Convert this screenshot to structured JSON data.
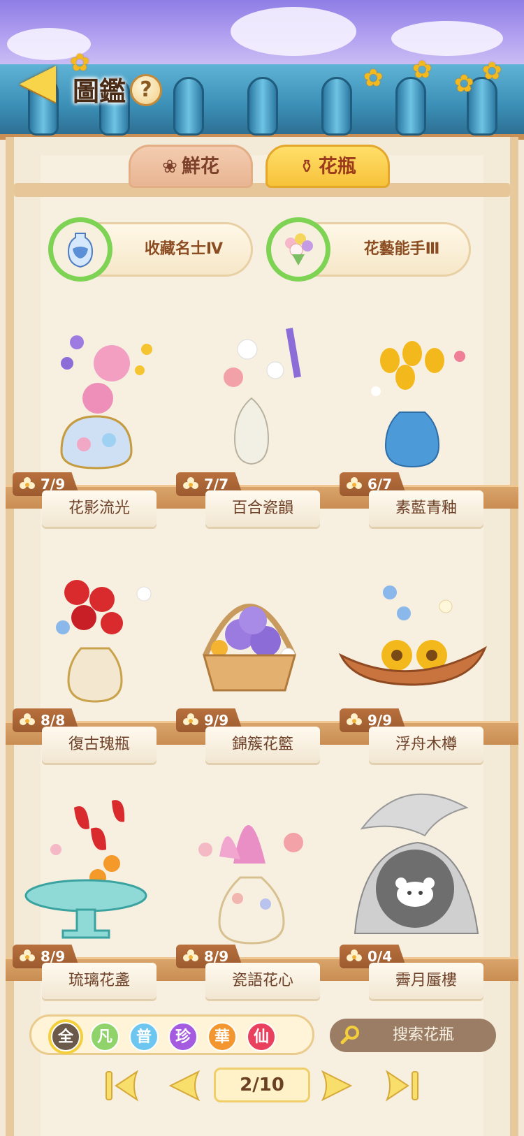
{
  "header": {
    "title": "圖鑑",
    "help_label": "?"
  },
  "tabs": [
    {
      "label": "鮮花",
      "active": false,
      "icon": "rose-icon"
    },
    {
      "label": "花瓶",
      "active": true,
      "icon": "vase-icon"
    }
  ],
  "achievements": [
    {
      "label": "收藏名士Ⅳ",
      "icon": "blue-vase-icon"
    },
    {
      "label": "花藝能手Ⅲ",
      "icon": "bouquet-icon"
    }
  ],
  "items": [
    {
      "name": "花影流光",
      "count": "7/9"
    },
    {
      "name": "百合瓷韻",
      "count": "7/7"
    },
    {
      "name": "素藍青釉",
      "count": "6/7"
    },
    {
      "name": "復古瑰瓶",
      "count": "8/8"
    },
    {
      "name": "錦簇花籃",
      "count": "9/9"
    },
    {
      "name": "浮舟木樽",
      "count": "9/9"
    },
    {
      "name": "琉璃花盞",
      "count": "8/9"
    },
    {
      "name": "瓷語花心",
      "count": "8/9"
    },
    {
      "name": "霽月蜃樓",
      "count": "0/4",
      "locked": true
    }
  ],
  "filters": [
    {
      "label": "全",
      "color": "#6b5a4a",
      "selected": true
    },
    {
      "label": "凡",
      "color": "#8fd36a"
    },
    {
      "label": "普",
      "color": "#6cc6ef"
    },
    {
      "label": "珍",
      "color": "#a45be0"
    },
    {
      "label": "華",
      "color": "#f3962f"
    },
    {
      "label": "仙",
      "color": "#e9405e"
    }
  ],
  "search": {
    "placeholder": "搜索花瓶"
  },
  "pagination": {
    "current": "2/10"
  }
}
